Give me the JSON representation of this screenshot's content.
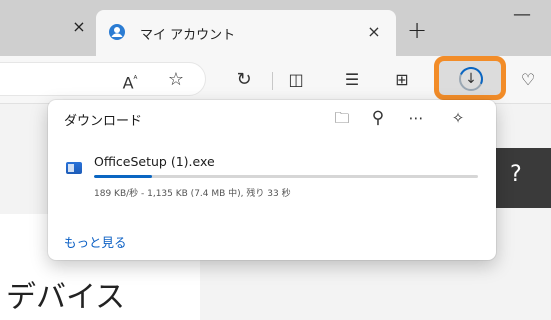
{
  "tabs": {
    "active_title": "マイ アカウント",
    "close_glyph": "×",
    "new_tab_glyph": "+",
    "minimize_glyph": "—"
  },
  "toolbar": {
    "read_aloud_glyph": "A",
    "read_aloud_sup": "ᴬ",
    "favorite_glyph": "☆",
    "refresh_glyph": "↻",
    "split_glyph": "◫",
    "favorites_glyph": "☰",
    "collections_glyph": "⊞",
    "download_glyph": "↓",
    "heart_glyph": "♡",
    "download_highlight_color": "#f28c28"
  },
  "downloads_panel": {
    "title": "ダウンロード",
    "folder_icon": "🗀",
    "search_icon": "⚲",
    "more_icon": "⋯",
    "pin_icon": "✧",
    "item": {
      "filename": "OfficeSetup (1).exe",
      "status": "189 KB/秒 - 1,135 KB (7.4 MB 中), 残り 33 秒",
      "progress_fraction": 0.15,
      "progress_color": "#0a66c2"
    },
    "more_link": "もっと見る"
  },
  "page": {
    "heading": "デバイス",
    "help_glyph": "?"
  }
}
